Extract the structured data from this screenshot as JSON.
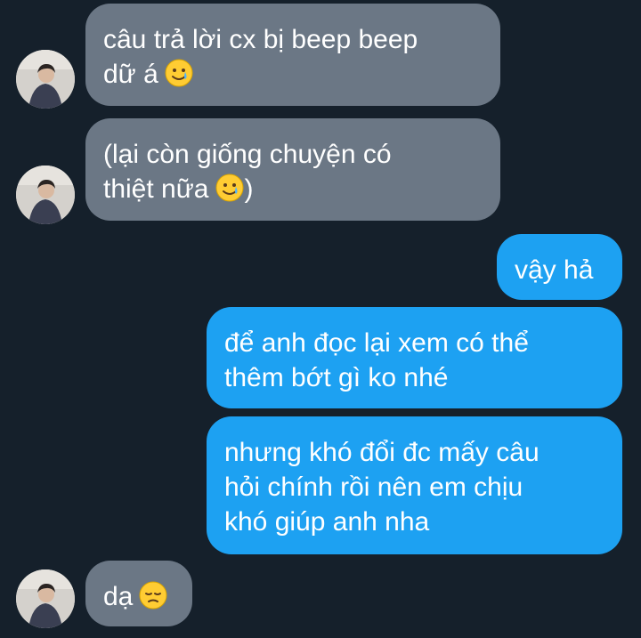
{
  "conversation": {
    "messages": [
      {
        "direction": "incoming",
        "lines": [
          "câu trả lời cx bị beep beep",
          "dữ á"
        ],
        "emoji": "smiling-face-with-tear"
      },
      {
        "direction": "incoming",
        "lines": [
          "(lại còn giống chuyện có",
          "thiệt nữa"
        ],
        "emoji": "smiling-face-with-tear",
        "suffix": ")"
      },
      {
        "direction": "outgoing",
        "lines": [
          "vậy hả"
        ]
      },
      {
        "direction": "outgoing",
        "lines": [
          "để anh đọc lại xem có thể",
          "thêm bớt gì ko nhé"
        ]
      },
      {
        "direction": "outgoing",
        "lines": [
          "nhưng khó đổi đc mấy câu",
          "hỏi chính rồi nên em chịu",
          "khó giúp anh nha"
        ]
      },
      {
        "direction": "incoming",
        "lines": [
          "dạ"
        ],
        "emoji": "pensive-face"
      }
    ]
  },
  "colors": {
    "background": "#15202b",
    "incoming_bubble": "#6b7785",
    "outgoing_bubble": "#1da1f2",
    "text": "#ffffff"
  }
}
